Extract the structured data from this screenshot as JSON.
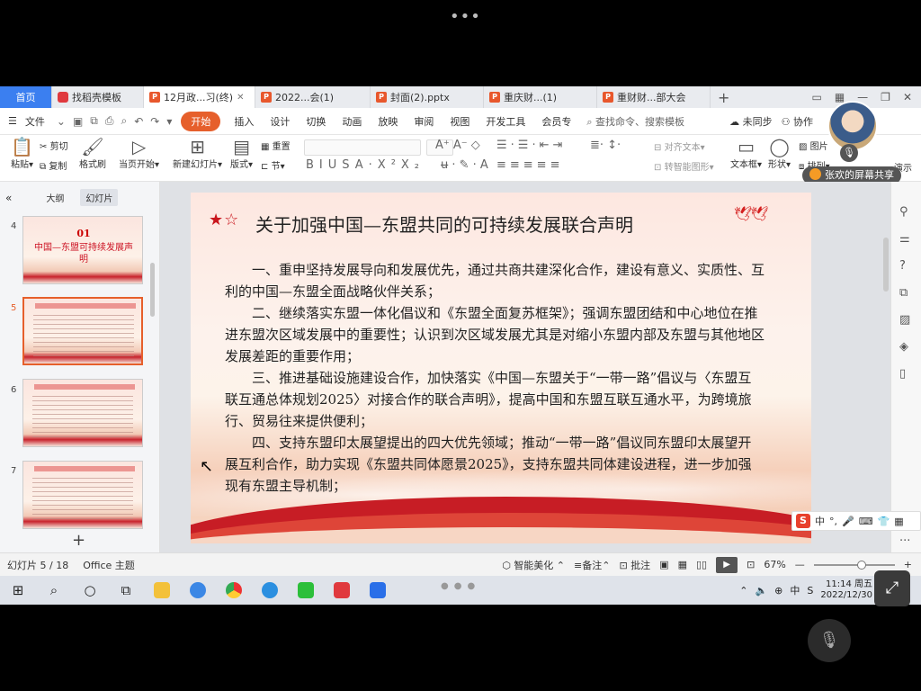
{
  "tabs": [
    {
      "label": "首页",
      "icon": "home-tab"
    },
    {
      "label": "找稻壳模板",
      "icon": "wps-icon"
    },
    {
      "label": "12月政...习(终)",
      "icon": "ppt-icon",
      "active": true
    },
    {
      "label": "2022...会(1)",
      "icon": "ppt-icon"
    },
    {
      "label": "封面(2).pptx",
      "icon": "ppt-icon"
    },
    {
      "label": "重庆财...(1)",
      "icon": "ppt-icon"
    },
    {
      "label": "重财财...部大会",
      "icon": "ppt-icon"
    }
  ],
  "menu": {
    "file": "文件",
    "items": [
      "开始",
      "插入",
      "设计",
      "切换",
      "动画",
      "放映",
      "审阅",
      "视图",
      "开发工具",
      "会员专"
    ],
    "search": "查找命令、搜索模板",
    "sync": "未同步",
    "collab": "协作"
  },
  "ribbon": {
    "paste": "粘贴",
    "cut": "剪切",
    "copy": "复制",
    "format_painter": "格式刷",
    "from_current": "当页开始",
    "new_slide": "新建幻灯片",
    "layout": "版式",
    "section": "节",
    "reset": "重置",
    "align_text": "对齐文本",
    "to_smartart": "转智能图形",
    "textbox": "文本框",
    "shape": "形状",
    "picture": "图片",
    "arrange": "排列",
    "present": "演示"
  },
  "share": {
    "label": "张欢的屏幕共享"
  },
  "left_panel": {
    "tabs": [
      "大纲",
      "幻灯片"
    ],
    "thumbs": [
      {
        "num": "4",
        "big": "01",
        "title": "中国—东盟可持续发展声明"
      },
      {
        "num": "5",
        "selected": true
      },
      {
        "num": "6"
      },
      {
        "num": "7"
      }
    ],
    "add": "+"
  },
  "slide": {
    "stars": "★☆",
    "title": "关于加强中国—东盟共同的可持续发展联合声明",
    "paragraphs": [
      "一、重申坚持发展导向和发展优先，通过共商共建深化合作，建设有意义、实质性、互利的中国—东盟全面战略伙伴关系；",
      "二、继续落实东盟一体化倡议和《东盟全面复苏框架》；强调东盟团结和中心地位在推进东盟次区域发展中的重要性；认识到次区域发展尤其是对缩小东盟内部及东盟与其他地区发展差距的重要作用；",
      "三、推进基础设施建设合作，加快落实《中国—东盟关于“一带一路”倡议与〈东盟互联互通总体规划2025〉对接合作的联合声明》，提高中国和东盟互联互通水平，为跨境旅行、贸易往来提供便利；",
      "四、支持东盟印太展望提出的四大优先领域；推动“一带一路”倡议同东盟印太展望开展互利合作，助力实现《东盟共同体愿景2025》，支持东盟共同体建设进程，进一步加强现有东盟主导机制；"
    ]
  },
  "ime": {
    "lang": "中"
  },
  "status": {
    "slide_count": "幻灯片 5 / 18",
    "theme": "Office 主题",
    "beautify": "智能美化",
    "notes": "备注",
    "comment": "批注",
    "zoom": "67%"
  },
  "taskbar": {
    "time": "11:14 周五",
    "date": "2022/12/30"
  }
}
